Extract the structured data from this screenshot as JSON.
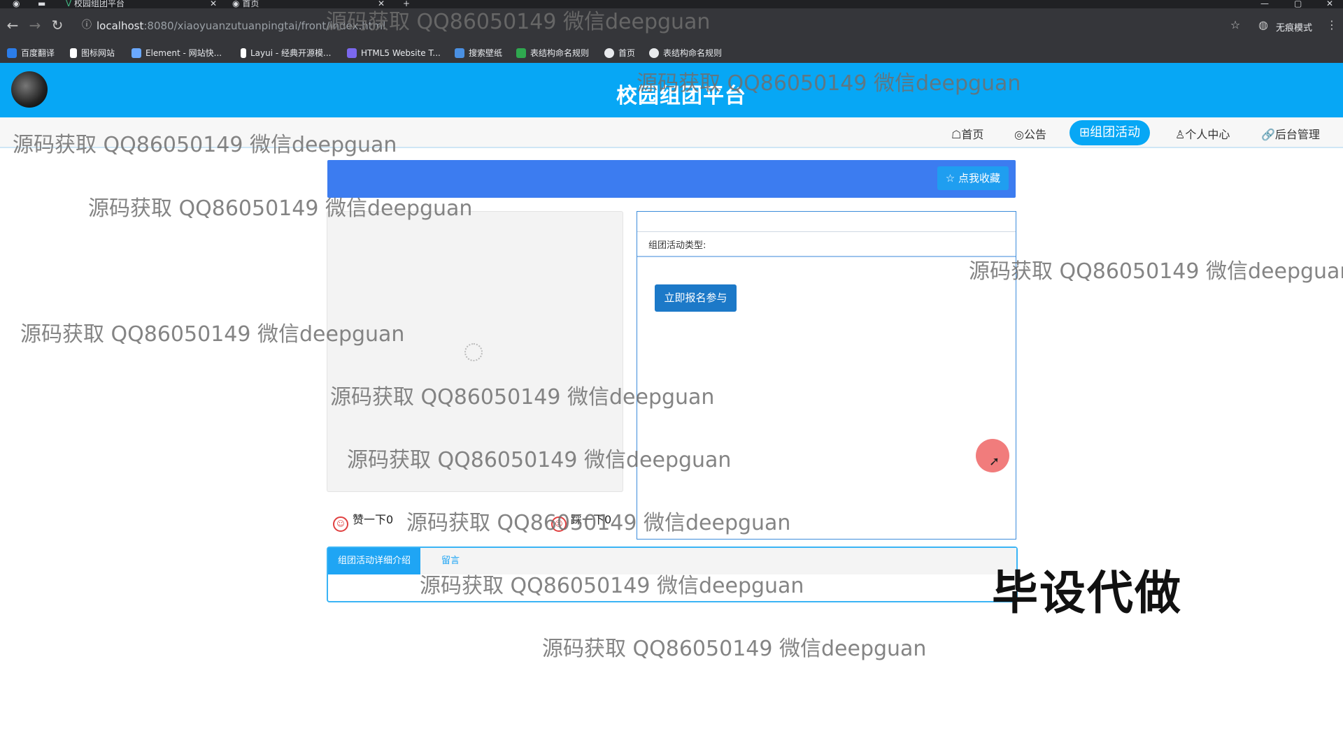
{
  "browser": {
    "tabs": [
      {
        "label": "校园组团平台"
      },
      {
        "label": "首页"
      }
    ],
    "url_host": "localhost",
    "url_path": ":8080/xiaoyuanzutuanpingtai/front/index.html",
    "incognito_label": "无痕模式",
    "bookmarks": [
      {
        "label": "百度翻译",
        "color": "#2b7de9"
      },
      {
        "label": "图标网站",
        "color": "#ffffff"
      },
      {
        "label": "Element - 网站快...",
        "color": "#6aa8ff"
      },
      {
        "label": "Layui - 经典开源模...",
        "color": "#ffffff"
      },
      {
        "label": "HTML5 Website T...",
        "color": "#7b68ee"
      },
      {
        "label": "搜索壁纸",
        "color": "#4a90e2"
      },
      {
        "label": "表结构命名规则",
        "color": "#2fa84f"
      },
      {
        "label": "首页",
        "color": "#e8eaed"
      },
      {
        "label": "表结构命名规则",
        "color": "#e8eaed"
      }
    ]
  },
  "header": {
    "site_title": "校园组团平台"
  },
  "nav": {
    "items": [
      {
        "label": "☖首页",
        "active": false
      },
      {
        "label": "◎公告",
        "active": false
      },
      {
        "label": "⊞组团活动",
        "active": true
      },
      {
        "label": "♙个人中心",
        "active": false
      },
      {
        "label": "🔗后台管理",
        "active": false
      }
    ]
  },
  "detail": {
    "favorite_label": "☆ 点我收藏",
    "type_label": "组团活动类型:",
    "signup_label": "立即报名参与",
    "like_label": "赞一下0",
    "dislike_label": "踩一下0",
    "tabs": [
      {
        "label": "组团活动详细介绍",
        "active": true
      },
      {
        "label": "留言",
        "active": false
      }
    ]
  },
  "watermarks": [
    "源码获取 QQ86050149 微信deepguan",
    "源码获取 QQ86050149 微信deepguan",
    "源码获取 QQ86050149 微信deepguan",
    "源码获取 QQ86050149 微信deepguan",
    "源码获取 QQ86050149 微信deepguan",
    "源码获取 QQ86050149 微信deepguan",
    "源码获取 QQ86050149 微信deepguan",
    "源码获取 QQ86050149 微信deepguan",
    "源码获取 QQ86050149 微信deepguan",
    "源码获取 QQ86050149 微信deepguan",
    "源码获取 QQ86050149 微信deepguan"
  ],
  "stamp_text": "毕设代做"
}
